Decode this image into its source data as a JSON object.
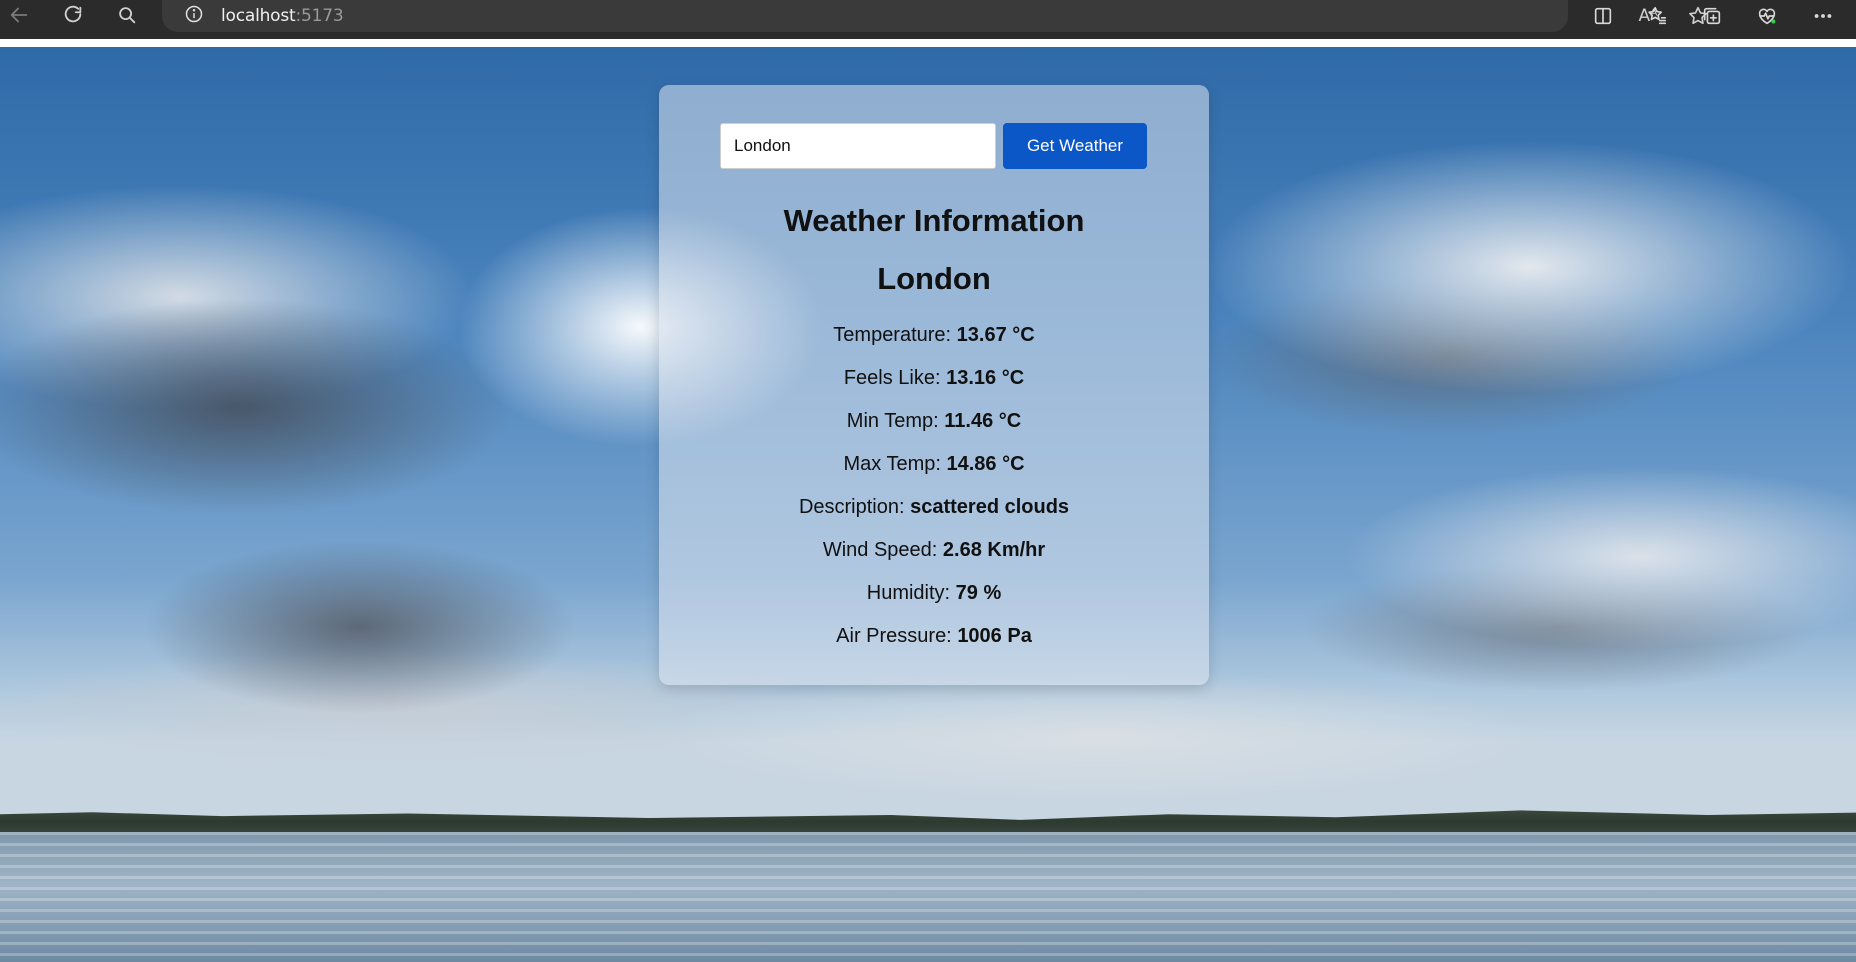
{
  "browser": {
    "url_host": "localhost",
    "url_port": ":5173",
    "read_aloud_label": "Aᴬ"
  },
  "weather_app": {
    "search": {
      "value": "London",
      "button_label": "Get Weather"
    },
    "heading": "Weather Information",
    "city": "London",
    "stats": [
      {
        "label": "Temperature: ",
        "value": "13.67 °C"
      },
      {
        "label": "Feels Like: ",
        "value": "13.16 °C"
      },
      {
        "label": "Min Temp: ",
        "value": "11.46 °C"
      },
      {
        "label": "Max Temp: ",
        "value": "14.86 °C"
      },
      {
        "label": "Description: ",
        "value": "scattered clouds"
      },
      {
        "label": "Wind Speed: ",
        "value": "2.68 Km/hr"
      },
      {
        "label": "Humidity: ",
        "value": "79 %"
      },
      {
        "label": "Air Pressure: ",
        "value": "1006 Pa"
      }
    ]
  },
  "colors": {
    "button_bg": "#0b57c8",
    "browser_bar": "#2b2b2b"
  }
}
